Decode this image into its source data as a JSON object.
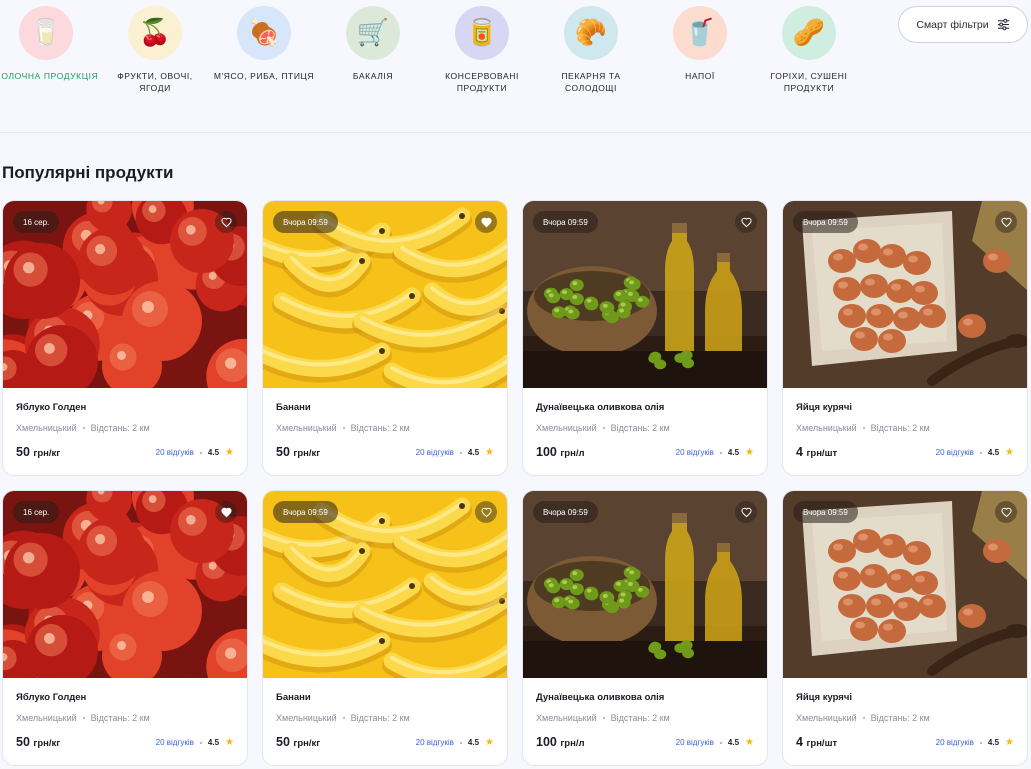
{
  "categories": [
    {
      "label": "МОЛОЧНА ПРОДУКЦІЯ",
      "icon": "milk-icon",
      "glyph": "🥛",
      "bg": "#fbd9dc",
      "active": true
    },
    {
      "label": "ФРУКТИ, ОВОЧІ, ЯГОДИ",
      "icon": "cherry-icon",
      "glyph": "🍒",
      "bg": "#fbf0d2",
      "active": false
    },
    {
      "label": "М'ЯСО, РИБА, ПТИЦЯ",
      "icon": "meat-icon",
      "glyph": "🍖",
      "bg": "#d7e6fb",
      "active": false
    },
    {
      "label": "БАКАЛІЯ",
      "icon": "cart-icon",
      "glyph": "🛒",
      "bg": "#dde9d8",
      "active": false
    },
    {
      "label": "КОНСЕРВОВАНІ ПРОДУКТИ",
      "icon": "can-icon",
      "glyph": "🥫",
      "bg": "#d8d7f3",
      "active": false
    },
    {
      "label": "ПЕКАРНЯ ТА СОЛОДОЩІ",
      "icon": "croissant-icon",
      "glyph": "🥐",
      "bg": "#cfe8ef",
      "active": false
    },
    {
      "label": "НАПОЇ",
      "icon": "drink-icon",
      "glyph": "🥤",
      "bg": "#fbdccf",
      "active": false
    },
    {
      "label": "ГОРІХИ, СУШЕНІ ПРОДУКТИ",
      "icon": "peanut-icon",
      "glyph": "🥜",
      "bg": "#cfeee0",
      "active": false
    }
  ],
  "smart_filters_label": "Смарт фільтри",
  "section_title": "Популярні продукти",
  "products": [
    {
      "name": "Яблуко Голден",
      "badge": "16 сер.",
      "city": "Хмельницький",
      "distance": "Відстань: 2 км",
      "price": "50",
      "unit": "грн/кг",
      "reviews": "20 відгуків",
      "rating": "4.5",
      "kind": "apple",
      "favorite": false
    },
    {
      "name": "Банани",
      "badge": "Вчора 09:59",
      "city": "Хмельницький",
      "distance": "Відстань: 2 км",
      "price": "50",
      "unit": "грн/кг",
      "reviews": "20 відгуків",
      "rating": "4.5",
      "kind": "banana",
      "favorite": true
    },
    {
      "name": "Дунаївецька оливкова олія",
      "badge": "Вчора 09:59",
      "city": "Хмельницький",
      "distance": "Відстань: 2 км",
      "price": "100",
      "unit": "грн/л",
      "reviews": "20 відгуків",
      "rating": "4.5",
      "kind": "oil",
      "favorite": false
    },
    {
      "name": "Яйця курячі",
      "badge": "Вчора 09:59",
      "city": "Хмельницький",
      "distance": "Відстань: 2 км",
      "price": "4",
      "unit": "грн/шт",
      "reviews": "20 відгуків",
      "rating": "4.5",
      "kind": "eggs",
      "favorite": false
    },
    {
      "name": "Яблуко Голден",
      "badge": "16 сер.",
      "city": "Хмельницький",
      "distance": "Відстань: 2 км",
      "price": "50",
      "unit": "грн/кг",
      "reviews": "20 відгуків",
      "rating": "4.5",
      "kind": "apple",
      "favorite": true
    },
    {
      "name": "Банани",
      "badge": "Вчора 09:59",
      "city": "Хмельницький",
      "distance": "Відстань: 2 км",
      "price": "50",
      "unit": "грн/кг",
      "reviews": "20 відгуків",
      "rating": "4.5",
      "kind": "banana",
      "favorite": false
    },
    {
      "name": "Дунаївецька оливкова олія",
      "badge": "Вчора 09:59",
      "city": "Хмельницький",
      "distance": "Відстань: 2 км",
      "price": "100",
      "unit": "грн/л",
      "reviews": "20 відгуків",
      "rating": "4.5",
      "kind": "oil",
      "favorite": false
    },
    {
      "name": "Яйця курячі",
      "badge": "Вчора 09:59",
      "city": "Хмельницький",
      "distance": "Відстань: 2 км",
      "price": "4",
      "unit": "грн/шт",
      "reviews": "20 відгуків",
      "rating": "4.5",
      "kind": "eggs",
      "favorite": false
    }
  ],
  "colors": {
    "accent": "#1a9a62",
    "link": "#3d63d6",
    "star": "#f5b90b"
  }
}
